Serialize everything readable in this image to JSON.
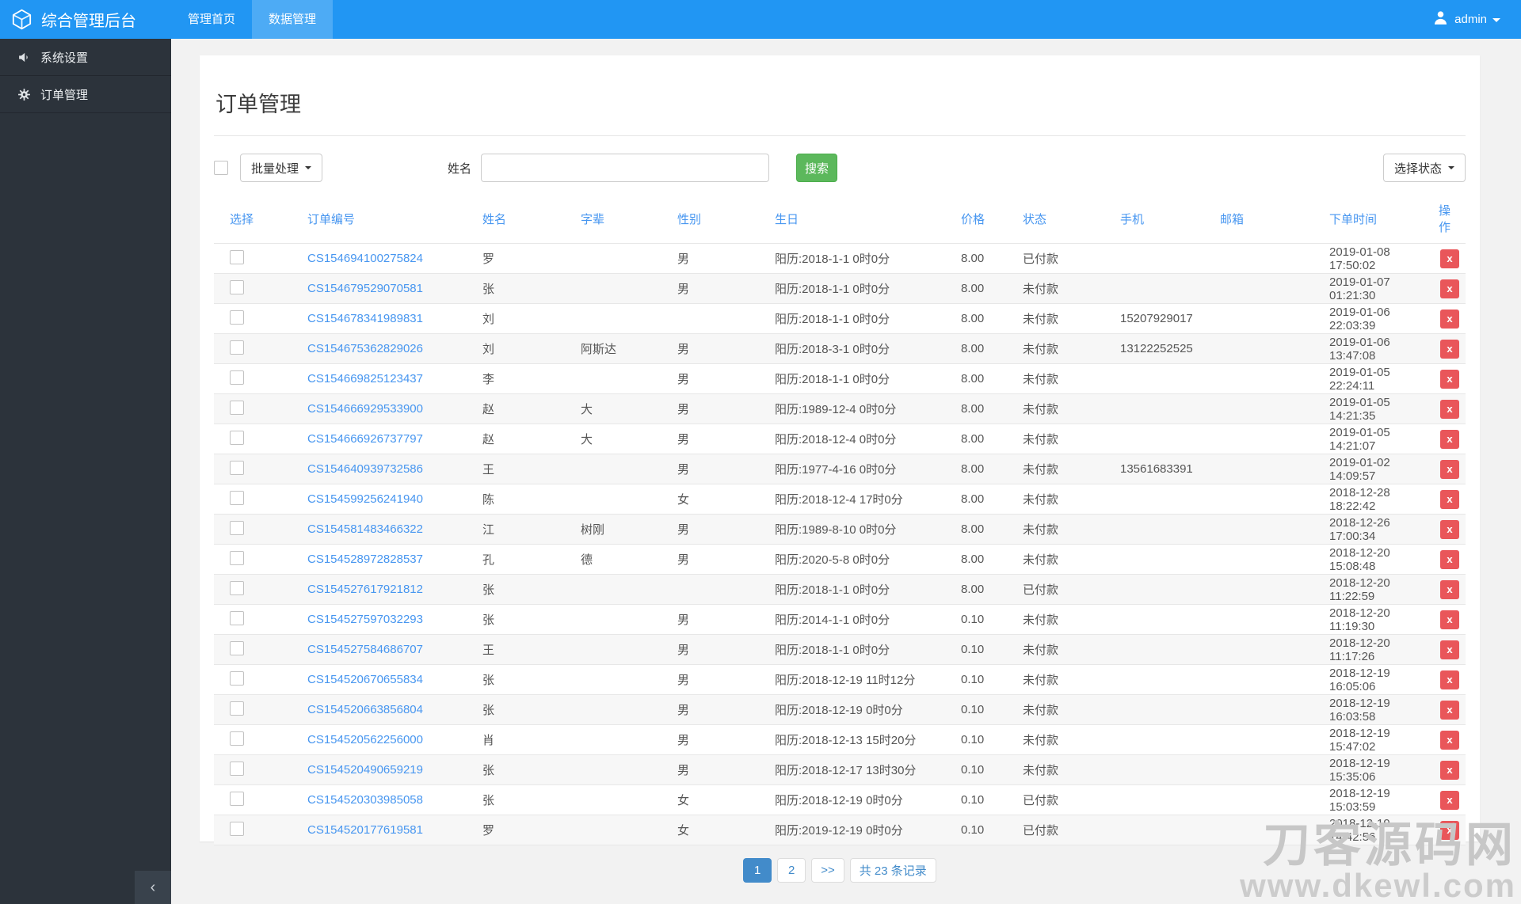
{
  "navbar": {
    "brand": "综合管理后台",
    "items": [
      {
        "label": "管理首页",
        "active": false
      },
      {
        "label": "数据管理",
        "active": true
      }
    ],
    "user": {
      "name": "admin"
    }
  },
  "sidebar": {
    "items": [
      {
        "label": "系统设置",
        "icon": "speaker-icon"
      },
      {
        "label": "订单管理",
        "icon": "gear-icon"
      }
    ]
  },
  "page": {
    "title": "订单管理"
  },
  "toolbar": {
    "batch_button": "批量处理",
    "name_label": "姓名",
    "name_input_value": "",
    "search_button": "搜索",
    "status_button": "选择状态"
  },
  "table": {
    "headers": [
      "选择",
      "订单编号",
      "姓名",
      "字辈",
      "性别",
      "生日",
      "价格",
      "状态",
      "手机",
      "邮箱",
      "下单时间",
      "操作"
    ],
    "delete_icon": "x",
    "rows": [
      {
        "order_no": "CS154694100275824",
        "name": "罗",
        "zibei": "",
        "gender": "男",
        "birthday": "阳历:2018-1-1 0时0分",
        "price": "8.00",
        "status": "已付款",
        "phone": "",
        "email": "",
        "time": "2019-01-08 17:50:02"
      },
      {
        "order_no": "CS154679529070581",
        "name": "张",
        "zibei": "",
        "gender": "男",
        "birthday": "阳历:2018-1-1 0时0分",
        "price": "8.00",
        "status": "未付款",
        "phone": "",
        "email": "",
        "time": "2019-01-07 01:21:30"
      },
      {
        "order_no": "CS154678341989831",
        "name": "刘",
        "zibei": "",
        "gender": "",
        "birthday": "阳历:2018-1-1 0时0分",
        "price": "8.00",
        "status": "未付款",
        "phone": "15207929017",
        "email": "",
        "time": "2019-01-06 22:03:39"
      },
      {
        "order_no": "CS154675362829026",
        "name": "刘",
        "zibei": "阿斯达",
        "gender": "男",
        "birthday": "阳历:2018-3-1 0时0分",
        "price": "8.00",
        "status": "未付款",
        "phone": "13122252525",
        "email": "",
        "time": "2019-01-06 13:47:08"
      },
      {
        "order_no": "CS154669825123437",
        "name": "李",
        "zibei": "",
        "gender": "男",
        "birthday": "阳历:2018-1-1 0时0分",
        "price": "8.00",
        "status": "未付款",
        "phone": "",
        "email": "",
        "time": "2019-01-05 22:24:11"
      },
      {
        "order_no": "CS154666929533900",
        "name": "赵",
        "zibei": "大",
        "gender": "男",
        "birthday": "阳历:1989-12-4 0时0分",
        "price": "8.00",
        "status": "未付款",
        "phone": "",
        "email": "",
        "time": "2019-01-05 14:21:35"
      },
      {
        "order_no": "CS154666926737797",
        "name": "赵",
        "zibei": "大",
        "gender": "男",
        "birthday": "阳历:2018-12-4 0时0分",
        "price": "8.00",
        "status": "未付款",
        "phone": "",
        "email": "",
        "time": "2019-01-05 14:21:07"
      },
      {
        "order_no": "CS154640939732586",
        "name": "王",
        "zibei": "",
        "gender": "男",
        "birthday": "阳历:1977-4-16 0时0分",
        "price": "8.00",
        "status": "未付款",
        "phone": "13561683391",
        "email": "",
        "time": "2019-01-02 14:09:57"
      },
      {
        "order_no": "CS154599256241940",
        "name": "陈",
        "zibei": "",
        "gender": "女",
        "birthday": "阳历:2018-12-4 17时0分",
        "price": "8.00",
        "status": "未付款",
        "phone": "",
        "email": "",
        "time": "2018-12-28 18:22:42"
      },
      {
        "order_no": "CS154581483466322",
        "name": "江",
        "zibei": "树刚",
        "gender": "男",
        "birthday": "阳历:1989-8-10 0时0分",
        "price": "8.00",
        "status": "未付款",
        "phone": "",
        "email": "",
        "time": "2018-12-26 17:00:34"
      },
      {
        "order_no": "CS154528972828537",
        "name": "孔",
        "zibei": "德",
        "gender": "男",
        "birthday": "阳历:2020-5-8 0时0分",
        "price": "8.00",
        "status": "未付款",
        "phone": "",
        "email": "",
        "time": "2018-12-20 15:08:48"
      },
      {
        "order_no": "CS154527617921812",
        "name": "张",
        "zibei": "",
        "gender": "",
        "birthday": "阳历:2018-1-1 0时0分",
        "price": "8.00",
        "status": "已付款",
        "phone": "",
        "email": "",
        "time": "2018-12-20 11:22:59"
      },
      {
        "order_no": "CS154527597032293",
        "name": "张",
        "zibei": "",
        "gender": "男",
        "birthday": "阳历:2014-1-1 0时0分",
        "price": "0.10",
        "status": "未付款",
        "phone": "",
        "email": "",
        "time": "2018-12-20 11:19:30"
      },
      {
        "order_no": "CS154527584686707",
        "name": "王",
        "zibei": "",
        "gender": "男",
        "birthday": "阳历:2018-1-1 0时0分",
        "price": "0.10",
        "status": "未付款",
        "phone": "",
        "email": "",
        "time": "2018-12-20 11:17:26"
      },
      {
        "order_no": "CS154520670655834",
        "name": "张",
        "zibei": "",
        "gender": "男",
        "birthday": "阳历:2018-12-19 11时12分",
        "price": "0.10",
        "status": "未付款",
        "phone": "",
        "email": "",
        "time": "2018-12-19 16:05:06"
      },
      {
        "order_no": "CS154520663856804",
        "name": "张",
        "zibei": "",
        "gender": "男",
        "birthday": "阳历:2018-12-19 0时0分",
        "price": "0.10",
        "status": "未付款",
        "phone": "",
        "email": "",
        "time": "2018-12-19 16:03:58"
      },
      {
        "order_no": "CS154520562256000",
        "name": "肖",
        "zibei": "",
        "gender": "男",
        "birthday": "阳历:2018-12-13 15时20分",
        "price": "0.10",
        "status": "未付款",
        "phone": "",
        "email": "",
        "time": "2018-12-19 15:47:02"
      },
      {
        "order_no": "CS154520490659219",
        "name": "张",
        "zibei": "",
        "gender": "男",
        "birthday": "阳历:2018-12-17 13时30分",
        "price": "0.10",
        "status": "未付款",
        "phone": "",
        "email": "",
        "time": "2018-12-19 15:35:06"
      },
      {
        "order_no": "CS154520303985058",
        "name": "张",
        "zibei": "",
        "gender": "女",
        "birthday": "阳历:2018-12-19 0时0分",
        "price": "0.10",
        "status": "已付款",
        "phone": "",
        "email": "",
        "time": "2018-12-19 15:03:59"
      },
      {
        "order_no": "CS154520177619581",
        "name": "罗",
        "zibei": "",
        "gender": "女",
        "birthday": "阳历:2019-12-19 0时0分",
        "price": "0.10",
        "status": "已付款",
        "phone": "",
        "email": "",
        "time": "2018-12-19 14:42:56"
      }
    ]
  },
  "pagination": {
    "page1": "1",
    "page2": "2",
    "next": ">>",
    "total": "共 23 条记录"
  },
  "watermark": {
    "line1": "刀客源码网",
    "line2": "www.dkewl.com"
  },
  "colors": {
    "navbar": "#2196f3",
    "navbar_active": "#4dabf5",
    "sidebar": "#2c333b",
    "link_blue": "#4796f0",
    "search_green": "#5cb85c",
    "delete_red": "#e9565a",
    "pagination_blue": "#428bca"
  }
}
